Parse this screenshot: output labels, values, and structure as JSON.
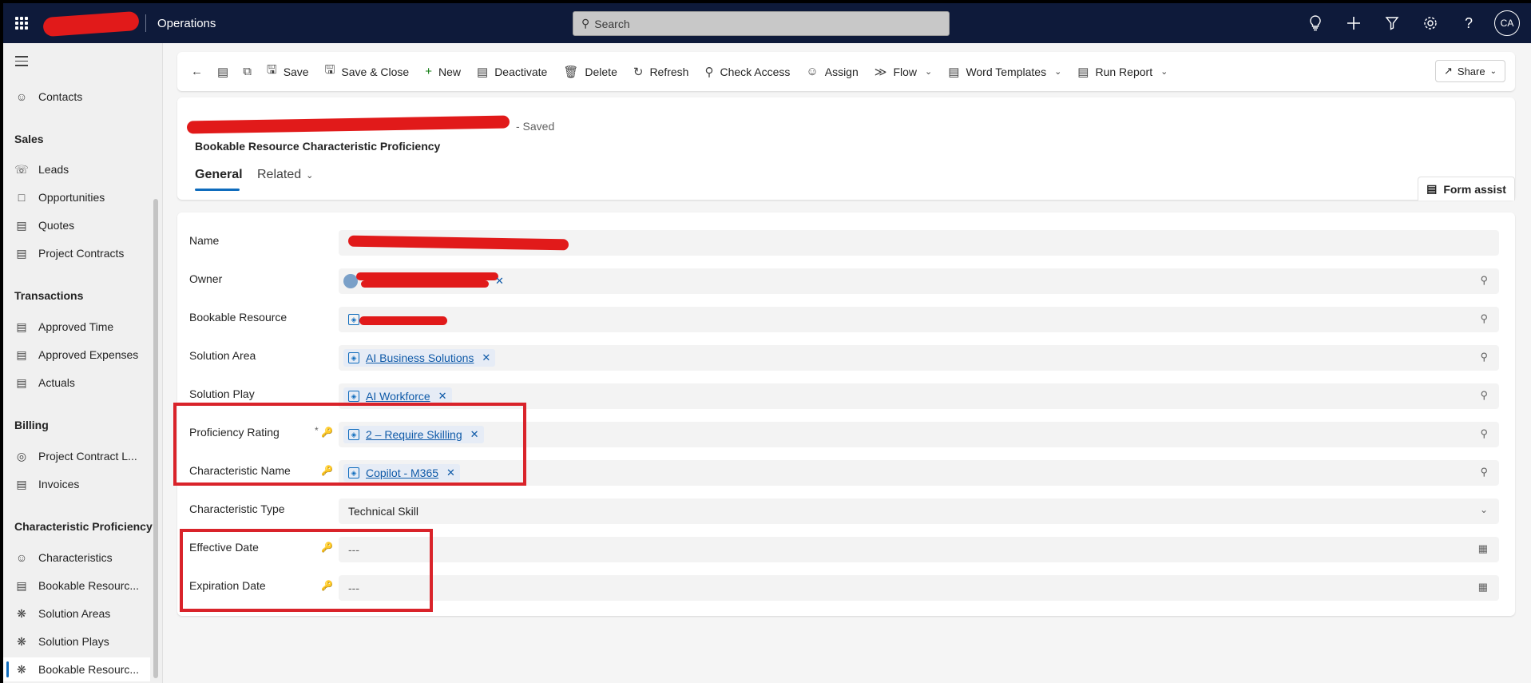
{
  "topbar": {
    "app_name": "Operations",
    "search_placeholder": "Search",
    "avatar_initials": "CA"
  },
  "sidenav": {
    "contacts": "Contacts",
    "group_sales": "Sales",
    "sales_items": [
      "Leads",
      "Opportunities",
      "Quotes",
      "Project Contracts"
    ],
    "group_transactions": "Transactions",
    "transactions_items": [
      "Approved Time",
      "Approved Expenses",
      "Actuals"
    ],
    "group_billing": "Billing",
    "billing_items": [
      "Project Contract L...",
      "Invoices"
    ],
    "group_characteristic": "Characteristic Proficiency",
    "characteristic_items": [
      "Characteristics",
      "Bookable Resourc...",
      "Solution Areas",
      "Solution Plays",
      "Bookable Resourc..."
    ]
  },
  "cmdbar": {
    "save": "Save",
    "save_close": "Save & Close",
    "new": "New",
    "deactivate": "Deactivate",
    "delete": "Delete",
    "refresh": "Refresh",
    "check_access": "Check Access",
    "assign": "Assign",
    "flow": "Flow",
    "word_templates": "Word Templates",
    "run_report": "Run Report",
    "share": "Share"
  },
  "header": {
    "saved_status": "- Saved",
    "entity_name": "Bookable Resource Characteristic Proficiency",
    "tabs": [
      "General",
      "Related"
    ],
    "form_assist": "Form assist"
  },
  "form": {
    "name_label": "Name",
    "owner_label": "Owner",
    "bookable_resource_label": "Bookable Resource",
    "solution_area_label": "Solution Area",
    "solution_area_value": "AI Business Solutions",
    "solution_play_label": "Solution Play",
    "solution_play_value": "AI Workforce",
    "proficiency_rating_label": "Proficiency Rating",
    "proficiency_rating_value": "2 – Require Skilling",
    "characteristic_name_label": "Characteristic Name",
    "characteristic_name_value": "Copilot - M365",
    "characteristic_type_label": "Characteristic Type",
    "characteristic_type_value": "Technical Skill",
    "effective_date_label": "Effective Date",
    "effective_date_value": "---",
    "expiration_date_label": "Expiration Date",
    "expiration_date_value": "---",
    "required_marker": "*"
  },
  "colors": {
    "header_bg": "#0e1a3a",
    "accent": "#0f6cbd",
    "highlight_red": "#d9232a"
  }
}
